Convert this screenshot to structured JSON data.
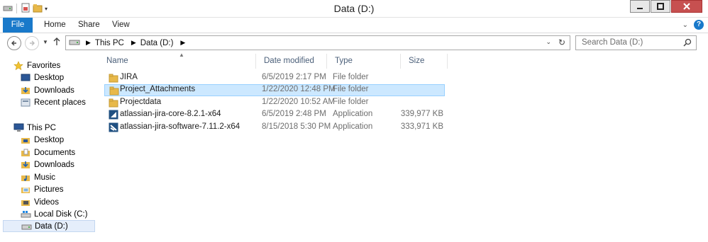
{
  "window": {
    "title": "Data (D:)"
  },
  "ribbon": {
    "tabs": [
      "File",
      "Home",
      "Share",
      "View"
    ]
  },
  "address": {
    "crumbs": [
      "This PC",
      "Data (D:)"
    ],
    "search_placeholder": "Search Data (D:)"
  },
  "nav": {
    "favorites_label": "Favorites",
    "favorites": [
      "Desktop",
      "Downloads",
      "Recent places"
    ],
    "thispc_label": "This PC",
    "thispc": [
      "Desktop",
      "Documents",
      "Downloads",
      "Music",
      "Pictures",
      "Videos",
      "Local Disk (C:)",
      "Data (D:)"
    ],
    "selected": "Data (D:)"
  },
  "columns": {
    "name": "Name",
    "date": "Date modified",
    "type": "Type",
    "size": "Size"
  },
  "files": [
    {
      "name": "JIRA",
      "date": "6/5/2019 2:17 PM",
      "type": "File folder",
      "size": "",
      "icon": "folder-icon"
    },
    {
      "name": "Project_Attachments",
      "date": "1/22/2020 12:48 PM",
      "type": "File folder",
      "size": "",
      "icon": "folder-icon",
      "selected": true
    },
    {
      "name": "Projectdata",
      "date": "1/22/2020 10:52 AM",
      "type": "File folder",
      "size": "",
      "icon": "folder-icon"
    },
    {
      "name": "atlassian-jira-core-8.2.1-x64",
      "date": "6/5/2019 2:48 PM",
      "type": "Application",
      "size": "339,977 KB",
      "icon": "application-icon"
    },
    {
      "name": "atlassian-jira-software-7.11.2-x64",
      "date": "8/15/2018 5:30 PM",
      "type": "Application",
      "size": "333,971 KB",
      "icon": "application-icon"
    }
  ],
  "colors": {
    "accent": "#1979ca",
    "selection": "#cce8ff",
    "folder": "#e8b94a"
  }
}
